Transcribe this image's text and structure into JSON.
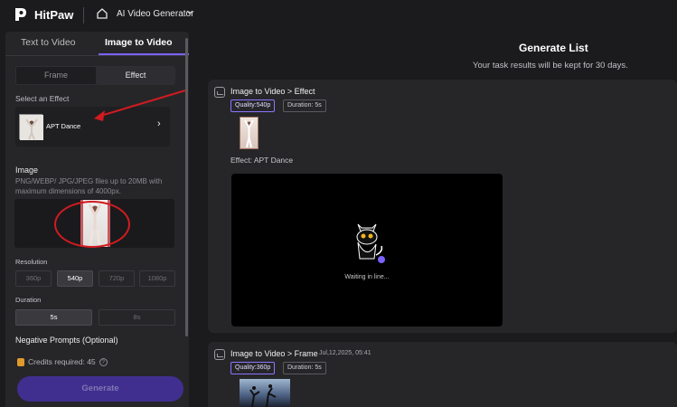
{
  "header": {
    "brand": "HitPaw",
    "app_title": "AI Video Generator"
  },
  "left_panel": {
    "tabs": [
      "Text to Video",
      "Image to Video"
    ],
    "mode_tabs": [
      "Frame",
      "Effect"
    ],
    "select_effect_label": "Select an Effect",
    "selected_effect": "APT Dance",
    "image_label": "Image",
    "image_help": "PNG/WEBP/ JPG/JPEG files up to 20MB with maximum dimensions of 4000px.",
    "resolution_label": "Resolution",
    "resolution_options": [
      "360p",
      "540p",
      "720p",
      "1080p"
    ],
    "resolution_selected": "540p",
    "duration_label": "Duration",
    "duration_options": [
      "5s",
      "8s"
    ],
    "duration_selected": "5s",
    "negative_prompts_label": "Negative Prompts (Optional)",
    "credits_text": "Credits required: 45",
    "generate_label": "Generate"
  },
  "main": {
    "title": "Generate List",
    "subtitle": "Your task results will be kept for 30 days.",
    "tasks": [
      {
        "title": "Image to Video > Effect",
        "date": "",
        "quality": "Quality:540p",
        "duration": "Duration: 5s",
        "effect_line": "Effect: APT Dance",
        "status": "Waiting in line..."
      },
      {
        "title": "Image to Video > Frame",
        "date": "Jul,12,2025, 05:41",
        "quality": "Quality:360p",
        "duration": "Duration: 5s"
      }
    ]
  },
  "colors": {
    "accent": "#7b62ff",
    "generate_bg": "#402f8f",
    "annotation_red": "#d11b20"
  }
}
